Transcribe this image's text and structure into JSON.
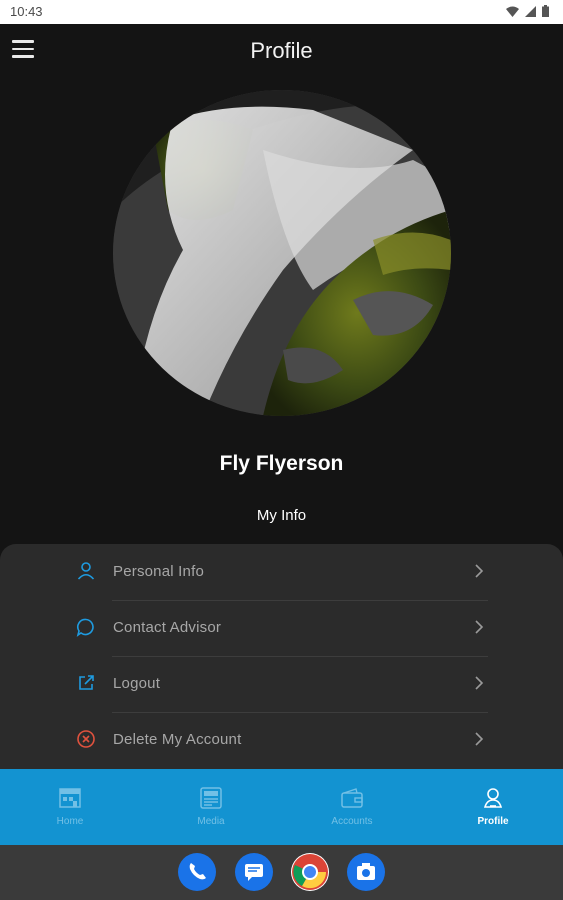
{
  "status_bar": {
    "time": "10:43"
  },
  "header": {
    "title": "Profile"
  },
  "profile": {
    "name": "Fly Flyerson",
    "section_label": "My Info"
  },
  "menu": [
    {
      "label": "Personal Info",
      "icon": "person-icon",
      "icon_color": "#1e9be0"
    },
    {
      "label": "Contact Advisor",
      "icon": "chat-bubble-icon",
      "icon_color": "#1e9be0"
    },
    {
      "label": "Logout",
      "icon": "external-link-icon",
      "icon_color": "#1e9be0"
    },
    {
      "label": "Delete My Account",
      "icon": "cancel-circle-icon",
      "icon_color": "#e0523e"
    }
  ],
  "bottom_nav": [
    {
      "label": "Home",
      "icon": "home-icon"
    },
    {
      "label": "Media",
      "icon": "media-icon"
    },
    {
      "label": "Accounts",
      "icon": "wallet-icon"
    },
    {
      "label": "Profile",
      "icon": "profile-icon",
      "active": true
    }
  ],
  "dock": [
    "phone-app-icon",
    "messages-app-icon",
    "chrome-app-icon",
    "camera-app-icon"
  ],
  "colors": {
    "accent": "#1393d1",
    "background": "#141414",
    "sheet": "#2b2b2b",
    "danger": "#e0523e"
  }
}
